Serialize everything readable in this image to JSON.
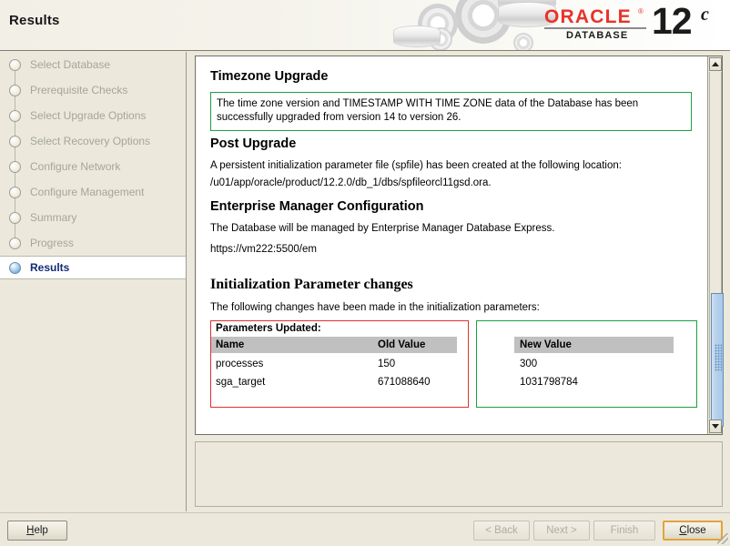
{
  "window": {
    "title": "Results"
  },
  "branding": {
    "oracle_word": "ORACLE",
    "registered_mark": "®",
    "product_line": "DATABASE",
    "version_number": "12",
    "version_suffix": "c"
  },
  "sidebar": {
    "items": [
      {
        "label": "Select Database",
        "state": "done"
      },
      {
        "label": "Prerequisite Checks",
        "state": "done"
      },
      {
        "label": "Select Upgrade Options",
        "state": "done"
      },
      {
        "label": "Select Recovery Options",
        "state": "done"
      },
      {
        "label": "Configure Network",
        "state": "done"
      },
      {
        "label": "Configure Management",
        "state": "done"
      },
      {
        "label": "Summary",
        "state": "done"
      },
      {
        "label": "Progress",
        "state": "done"
      },
      {
        "label": "Results",
        "state": "active"
      }
    ]
  },
  "content": {
    "timezone": {
      "heading": "Timezone Upgrade",
      "message": "The time zone version and TIMESTAMP WITH TIME ZONE data of the Database has been successfully upgraded from version 14 to version 26.",
      "box_border_color": "#1f9e42"
    },
    "post_upgrade": {
      "heading": "Post Upgrade",
      "line1": "A persistent initialization parameter file (spfile) has been created at the following location:",
      "line2": "/u01/app/oracle/product/12.2.0/db_1/dbs/spfileorcl11gsd.ora."
    },
    "enterprise_manager": {
      "heading": "Enterprise Manager Configuration",
      "line1": "The Database will be managed by Enterprise Manager Database Express.",
      "url": "https://vm222:5500/em"
    },
    "init_params": {
      "heading": "Initialization Parameter changes",
      "intro": "The following changes have been made in the initialization parameters:",
      "caption": "Parameters Updated:",
      "columns": [
        "Name",
        "Old Value",
        "New Value"
      ],
      "rows": [
        {
          "name": "processes",
          "old_value": "150",
          "new_value": "300"
        },
        {
          "name": "sga_target",
          "old_value": "671088640",
          "new_value": "1031798784"
        }
      ],
      "highlight_old_color": "#e03030",
      "highlight_new_color": "#1f9e42"
    }
  },
  "scrollbar": {
    "up_icon": "triangle-up-icon",
    "down_icon": "triangle-down-icon"
  },
  "footer": {
    "help": {
      "label": "Help",
      "mnemonic": "H",
      "enabled": true
    },
    "back": {
      "label": "< Back",
      "enabled": false
    },
    "next": {
      "label": "Next >",
      "enabled": false
    },
    "finish": {
      "label": "Finish",
      "enabled": false
    },
    "close": {
      "label": "Close",
      "mnemonic": "C",
      "enabled": true,
      "focus_color": "#e2a33c"
    }
  }
}
